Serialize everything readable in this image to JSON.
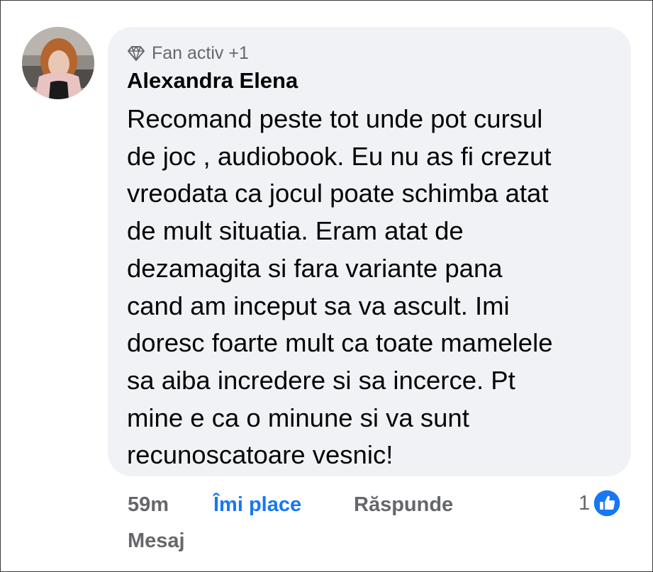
{
  "comment": {
    "badge": "Fan activ +1",
    "author": "Alexandra Elena",
    "text": "Recomand peste tot unde pot cursul\nde joc , audiobook. Eu nu as fi crezut\nvreodata ca jocul poate schimba atat\nde mult situatia. Eram atat de\ndezamagita si fara variante pana\ncand am inceput sa va ascult. Imi\ndoresc foarte mult ca toate mamelele\nsa aiba incredere si sa incerce. Pt\nmine e ca o minune si va sunt\nrecunoscatoare vesnic!",
    "time": "59m",
    "like_label": "Îmi place",
    "reply_label": "Răspunde",
    "message_label": "Mesaj",
    "reaction_count": "1"
  },
  "colors": {
    "bubble": "#f0f2f5",
    "accent": "#1877f2",
    "muted": "#65676b",
    "text": "#050505"
  },
  "icons": {
    "badge": "diamond-icon",
    "reaction": "like-thumb-icon"
  }
}
